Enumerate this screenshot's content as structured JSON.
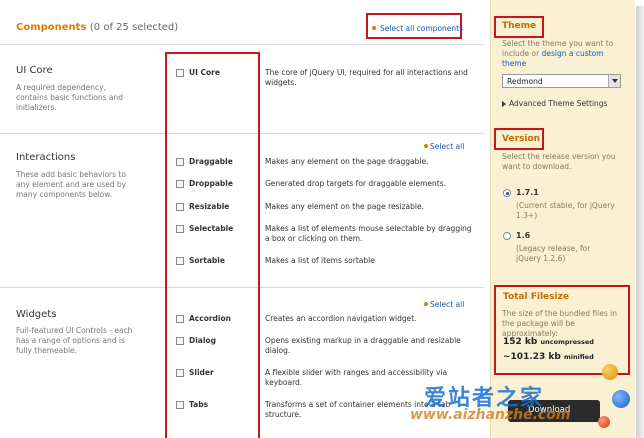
{
  "components": {
    "title": "Components",
    "count": "(0 of 25 selected)",
    "select_all_components": "Select all components"
  },
  "sections": [
    {
      "title": "UI Core",
      "desc": "A required dependency, contains basic functions and initializers.",
      "select_all": "",
      "items": [
        {
          "name": "UI Core",
          "desc": "The core of jQuery UI, required for all interactions and widgets."
        }
      ]
    },
    {
      "title": "Interactions",
      "desc": "These add basic behaviors to any element and are used by many components below.",
      "select_all": "Select all",
      "items": [
        {
          "name": "Draggable",
          "desc": "Makes any element on the page draggable."
        },
        {
          "name": "Droppable",
          "desc": "Generated drop targets for draggable elements."
        },
        {
          "name": "Resizable",
          "desc": "Makes any element on the page resizable."
        },
        {
          "name": "Selectable",
          "desc": "Makes a list of elements mouse selectable by dragging a box or clicking on them."
        },
        {
          "name": "Sortable",
          "desc": "Makes a list of items sortable"
        }
      ]
    },
    {
      "title": "Widgets",
      "desc": "Full-featured UI Controls - each has a range of options and is fully themeable.",
      "select_all": "Select all",
      "items": [
        {
          "name": "Accordion",
          "desc": "Creates an accordion navigation widget."
        },
        {
          "name": "Dialog",
          "desc": "Opens existing markup in a draggable and resizable dialog."
        },
        {
          "name": "Slider",
          "desc": "A flexible slider with ranges and accessibility via keyboard."
        },
        {
          "name": "Tabs",
          "desc": "Transforms a set of container elements into a tab structure."
        }
      ]
    }
  ],
  "theme": {
    "heading": "Theme",
    "desc_before": "Select the theme you want to include or",
    "desc_link": "design a custom theme",
    "selected": "Redmond",
    "advanced": "Advanced Theme Settings"
  },
  "version": {
    "heading": "Version",
    "desc": "Select the release version you want to download.",
    "options": [
      {
        "label": "1.7.1",
        "note": "(Current stable, for jQuery 1.3+)",
        "selected": true
      },
      {
        "label": "1.6",
        "note": "(Legacy release, for jQuery 1.2.6)",
        "selected": false
      }
    ]
  },
  "filesize": {
    "heading": "Total Filesize",
    "desc": "The size of the bundled files in the package will be approximately:",
    "uncompressed_value": "152 kb",
    "uncompressed_label": "uncompressed",
    "minified_value": "~101.23 kb",
    "minified_label": "minified"
  },
  "download": {
    "label": "Download"
  },
  "watermark": {
    "cn": "爱站者之家",
    "url": "www.aizhanzhe.com"
  },
  "colors": {
    "accent": "#e07b00",
    "link": "#1a55b0",
    "highlight": "#c4161c",
    "sidebar_bg": "#faf1d5"
  }
}
